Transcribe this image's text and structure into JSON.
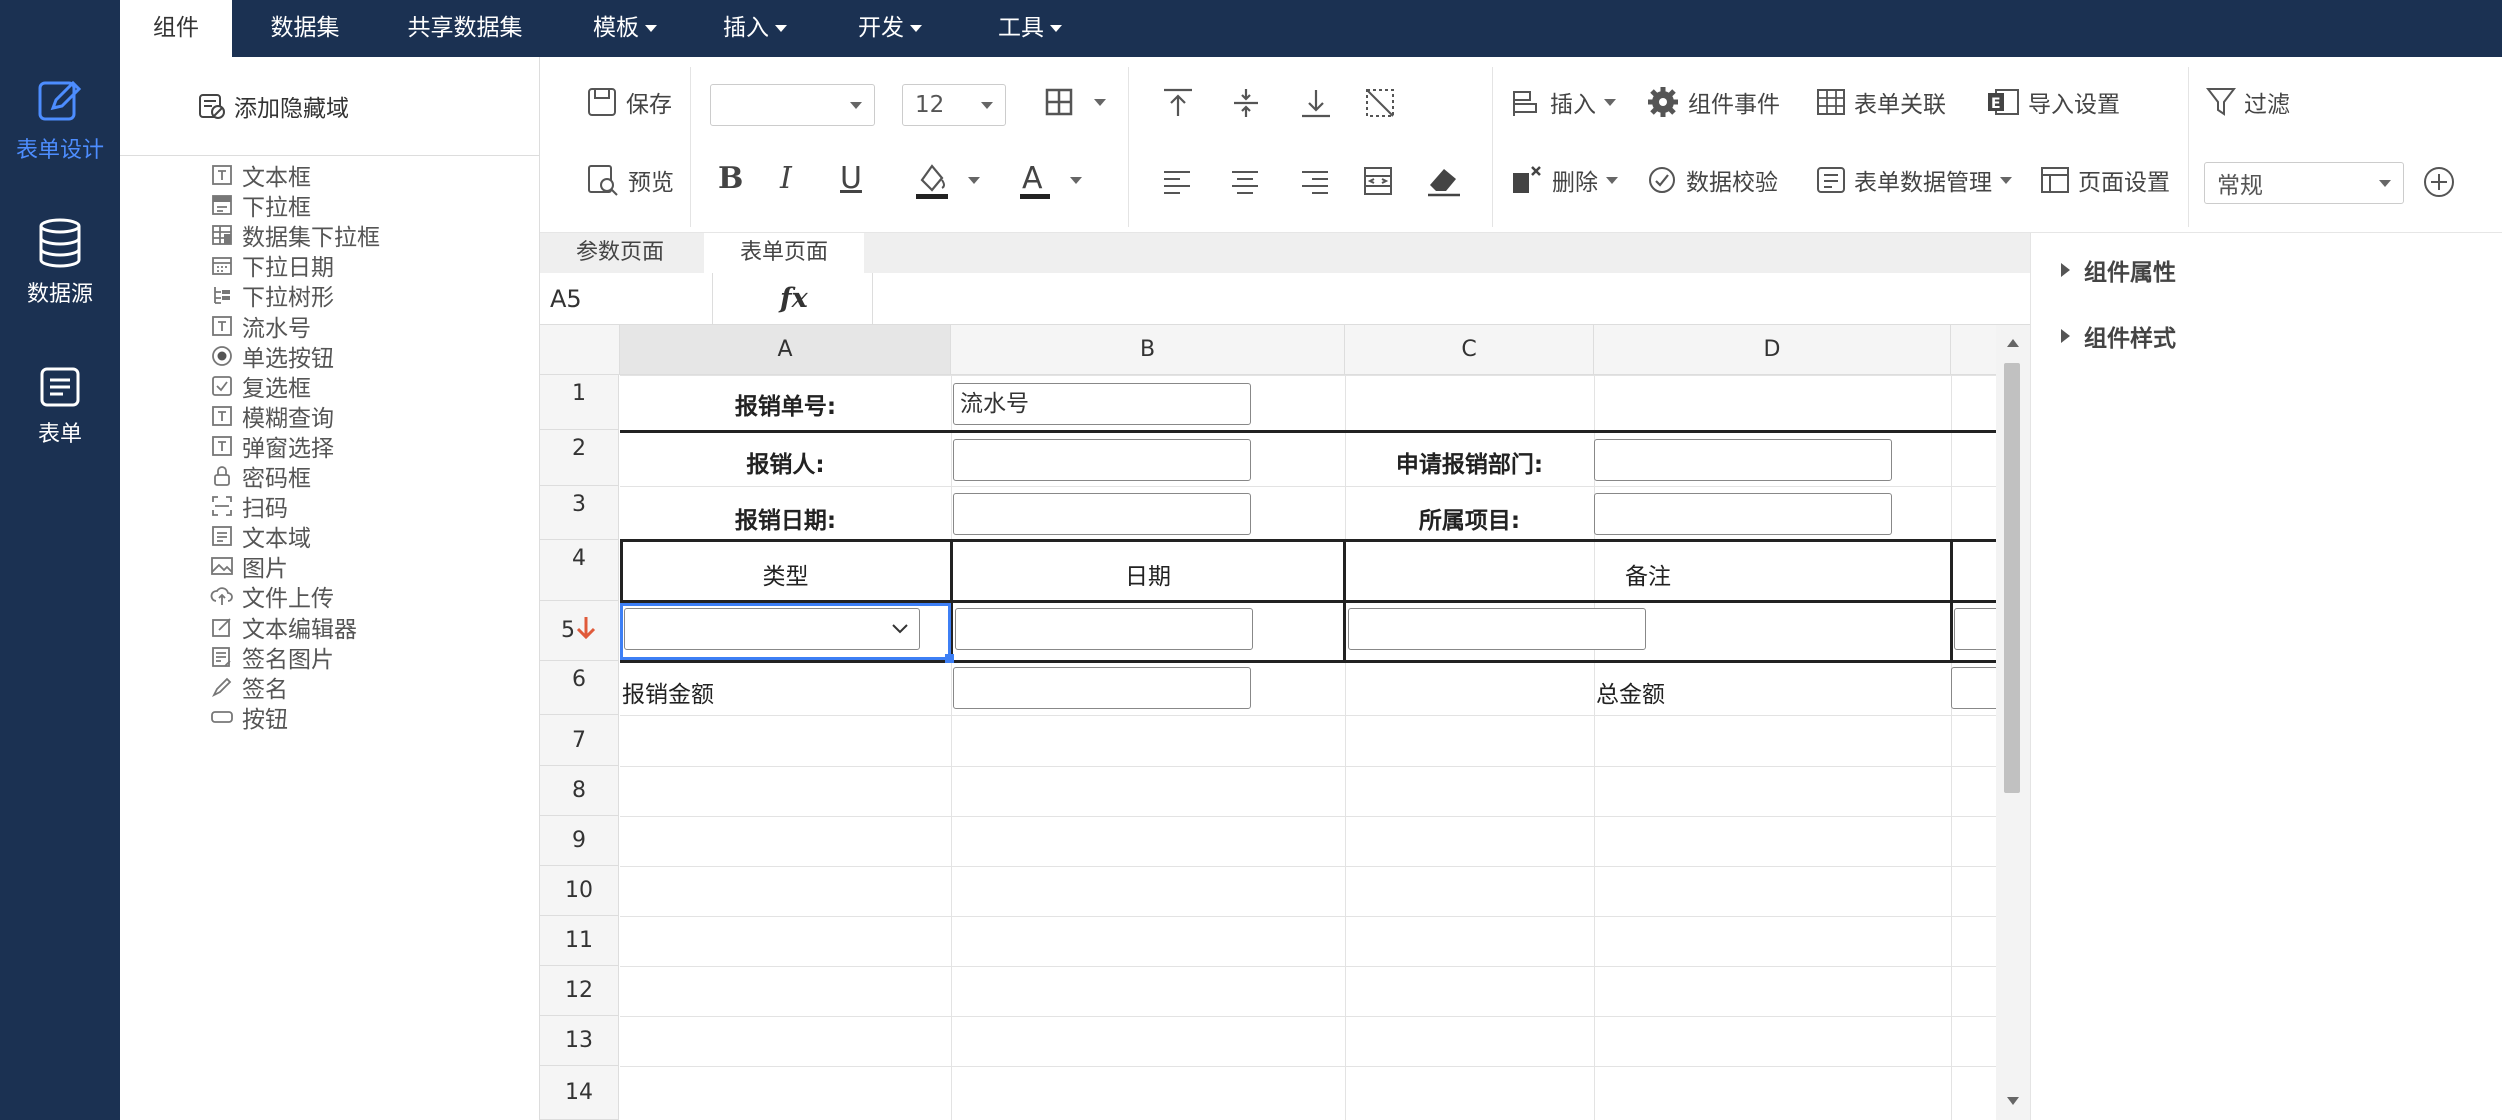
{
  "colors": {
    "nav_bg": "#1b3152",
    "accent": "#4d8dff",
    "red_arrow": "#e05a3a"
  },
  "leftnav": {
    "items": [
      {
        "label": "表单设计",
        "icon": "pencil-edit-icon",
        "active": true
      },
      {
        "label": "数据源",
        "icon": "database-icon",
        "active": false
      },
      {
        "label": "表单",
        "icon": "form-icon",
        "active": false
      }
    ]
  },
  "topbar": {
    "tabs": [
      "组件",
      "数据集",
      "共享数据集",
      "模板",
      "插入",
      "开发",
      "工具"
    ]
  },
  "components": {
    "header": "添加隐藏域",
    "items": [
      "文本框",
      "下拉框",
      "数据集下拉框",
      "下拉日期",
      "下拉树形",
      "流水号",
      "单选按钮",
      "复选框",
      "模糊查询",
      "弹窗选择",
      "密码框",
      "扫码",
      "文本域",
      "图片",
      "文件上传",
      "文本编辑器",
      "签名图片",
      "签名",
      "按钮"
    ]
  },
  "toolbar": {
    "save": "保存",
    "preview": "预览",
    "font_size": "12",
    "insert": "插入",
    "delete": "删除",
    "component_event": "组件事件",
    "data_validation": "数据校验",
    "form_link": "表单关联",
    "form_data_mgmt": "表单数据管理",
    "import_settings": "导入设置",
    "page_settings": "页面设置",
    "filter": "过滤",
    "format_select": "常规"
  },
  "sheet_tabs": [
    "参数页面",
    "表单页面"
  ],
  "formula_bar": {
    "cell_ref": "A5",
    "fx": "fx"
  },
  "grid": {
    "columns": [
      "A",
      "B",
      "C",
      "D"
    ],
    "rows": [
      "1",
      "2",
      "3",
      "4",
      "5",
      "6",
      "7",
      "8",
      "9",
      "10",
      "11",
      "12",
      "13",
      "14"
    ],
    "labels": {
      "r1_a": "报销单号:",
      "r1_b_value": "流水号",
      "r2_a": "报销人:",
      "r2_c": "申请报销部门:",
      "r3_a": "报销日期:",
      "r3_c": "所属项目:",
      "r4_a": "类型",
      "r4_b": "日期",
      "r4_c": "备注",
      "r6_a": "报销金额",
      "r6_d": "总金额"
    }
  },
  "right_panel": {
    "sections": [
      "组件属性",
      "组件样式"
    ]
  }
}
